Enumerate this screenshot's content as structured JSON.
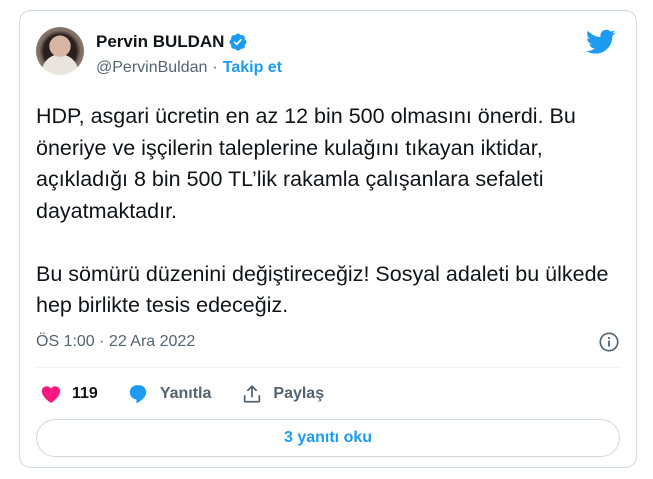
{
  "author": {
    "name": "Pervin BULDAN",
    "handle": "@PervinBuldan",
    "separator": "·",
    "follow_label": "Takip et",
    "verified_icon": "verified-badge-icon",
    "avatar": "profile-photo"
  },
  "tweet": {
    "text": "HDP, asgari ücretin en az 12 bin 500 olmasını önerdi. Bu öneriye ve işçilerin taleplerine kulağını tıkayan iktidar, açıkladığı 8 bin 500 TL’lik rakamla çalışanlara sefaleti dayatmaktadır.\n\nBu sömürü düzenini değiştireceğiz! Sosyal adaleti bu ülkede hep birlikte tesis edeceğiz.",
    "timestamp": "ÖS 1:00 · 22 Ara 2022"
  },
  "actions": {
    "like_count": "119",
    "reply_label": "Yanıtla",
    "share_label": "Paylaş"
  },
  "replies_button": "3 yanıtı oku",
  "colors": {
    "accent": "#1d9bf0",
    "like": "#f91880",
    "muted": "#536471",
    "text": "#0f1419"
  }
}
